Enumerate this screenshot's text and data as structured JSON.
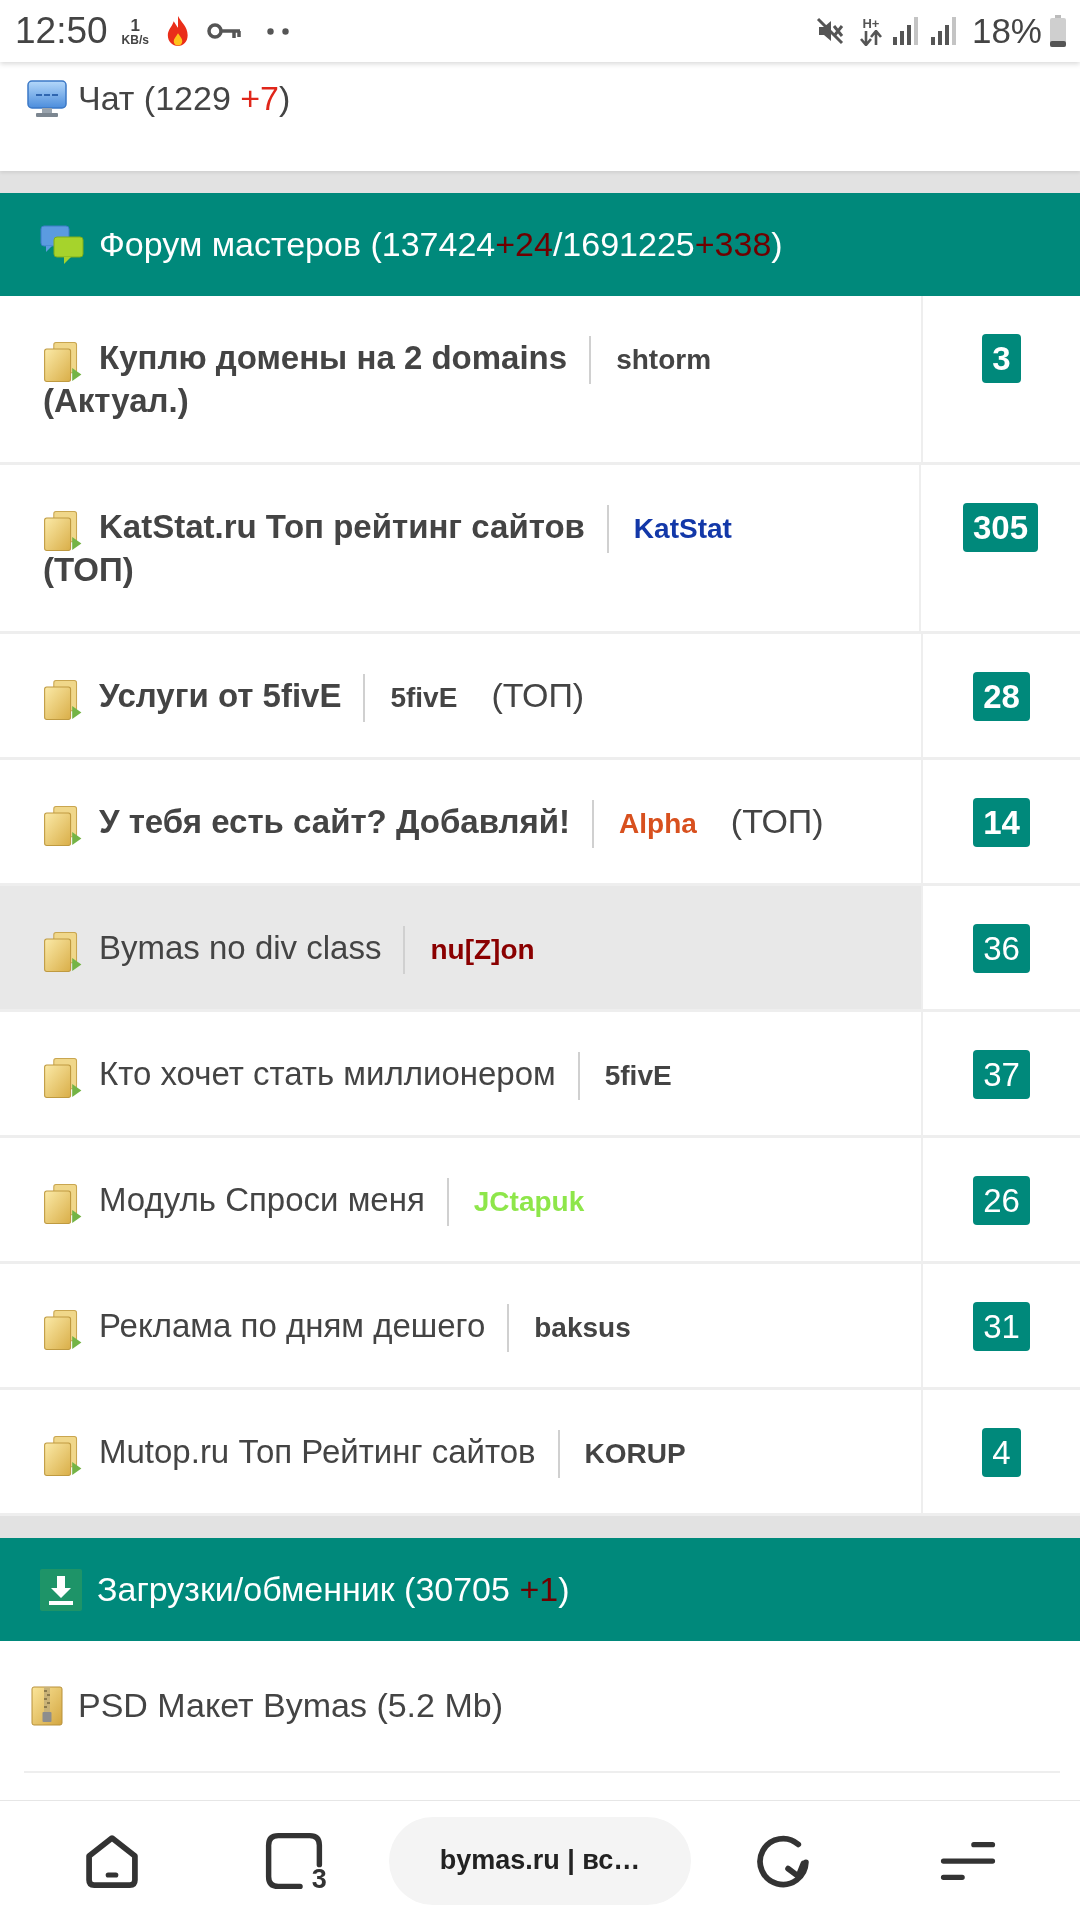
{
  "status_bar": {
    "time": "12:50",
    "speed_value": "1",
    "speed_unit": "KB/s",
    "network_type": "H+",
    "battery": "18%"
  },
  "chat": {
    "segments": [
      {
        "text": "Чат (1229 ",
        "kind": "plain"
      },
      {
        "text": "+7",
        "kind": "new"
      },
      {
        "text": ")",
        "kind": "plain"
      }
    ]
  },
  "forum": {
    "header": {
      "segments": [
        {
          "text": "Форум мастеров (137424",
          "kind": "plain"
        },
        {
          "text": "+24",
          "kind": "new"
        },
        {
          "text": "/1691225",
          "kind": "plain"
        },
        {
          "text": "+338",
          "kind": "new"
        },
        {
          "text": ")",
          "kind": "plain"
        }
      ]
    },
    "topics": [
      {
        "title": "Куплю домены на 2 domains",
        "bold_title": true,
        "author": "shtorm",
        "color": "#444444",
        "suffix": "(Актуал.)",
        "suffix_bold": true,
        "highlighted": false,
        "replies": "3"
      },
      {
        "title": "KatStat.ru Топ рейтинг сайтов",
        "bold_title": true,
        "author": "KatStat",
        "color": "#1338a8",
        "suffix": "(ТОП)",
        "suffix_bold": true,
        "highlighted": false,
        "replies": "305"
      },
      {
        "title": "Услуги от 5fivE",
        "bold_title": true,
        "author": "5fivE",
        "color": "#444444",
        "suffix": "(ТОП)",
        "suffix_bold": false,
        "highlighted": false,
        "replies": "28"
      },
      {
        "title": "У тебя есть сайт? Добавляй!",
        "bold_title": true,
        "author": "Alpha",
        "color": "#d8501e",
        "suffix": "(ТОП)",
        "suffix_bold": false,
        "highlighted": false,
        "replies": "14"
      },
      {
        "title": "Bymas no div class",
        "bold_title": false,
        "author": "nu[Z]on",
        "color": "#8a0000",
        "highlighted": true,
        "replies": "36"
      },
      {
        "title": "Кто хочет стать миллионером",
        "bold_title": false,
        "author": "5fivE",
        "color": "#444444",
        "highlighted": false,
        "replies": "37"
      },
      {
        "title": "Модуль Спроси меня",
        "bold_title": false,
        "author": "JCtapuk",
        "color": "#8ee64a",
        "highlighted": false,
        "replies": "26"
      },
      {
        "title": "Реклама по дням дешего",
        "bold_title": false,
        "author": "baksus",
        "color": "#444444",
        "highlighted": false,
        "replies": "31"
      },
      {
        "title": "Mutop.ru Топ Рейтинг сайтов",
        "bold_title": false,
        "author": "KORUP",
        "color": "#444444",
        "highlighted": false,
        "replies": "4"
      }
    ]
  },
  "downloads": {
    "header": {
      "segments": [
        {
          "text": "Загрузки/обменник (30705 ",
          "kind": "plain"
        },
        {
          "text": "+1",
          "kind": "new"
        },
        {
          "text": ")",
          "kind": "plain"
        }
      ]
    },
    "files": [
      {
        "name": "PSD Макет Bymas (5.2 Mb)"
      }
    ]
  },
  "browser_bar": {
    "tab_count": "3",
    "address": "bymas.ru | вс…"
  }
}
